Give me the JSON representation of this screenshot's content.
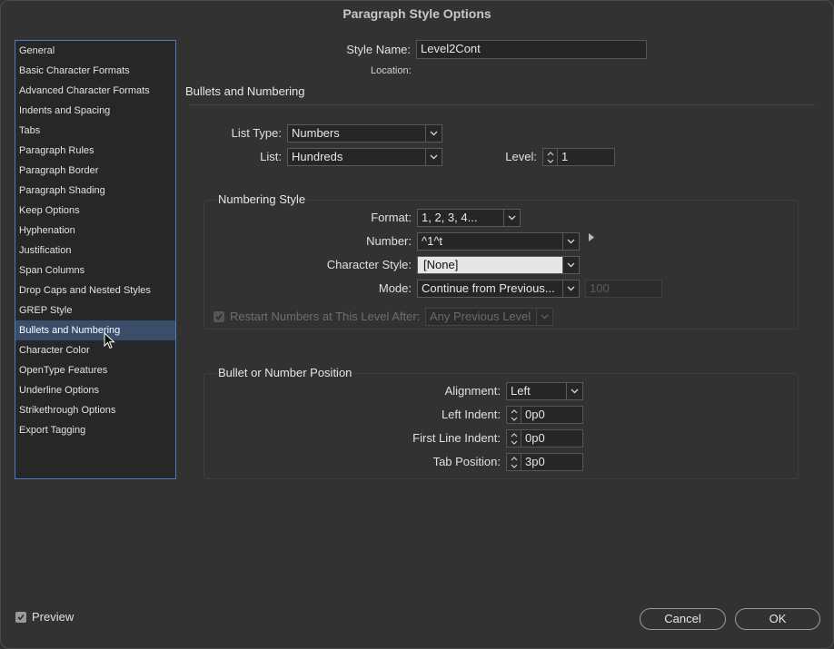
{
  "dialog": {
    "title": "Paragraph Style Options"
  },
  "sidebar": {
    "items": [
      {
        "label": "General"
      },
      {
        "label": "Basic Character Formats"
      },
      {
        "label": "Advanced Character Formats"
      },
      {
        "label": "Indents and Spacing"
      },
      {
        "label": "Tabs"
      },
      {
        "label": "Paragraph Rules"
      },
      {
        "label": "Paragraph Border"
      },
      {
        "label": "Paragraph Shading"
      },
      {
        "label": "Keep Options"
      },
      {
        "label": "Hyphenation"
      },
      {
        "label": "Justification"
      },
      {
        "label": "Span Columns"
      },
      {
        "label": "Drop Caps and Nested Styles"
      },
      {
        "label": "GREP Style"
      },
      {
        "label": "Bullets and Numbering",
        "selected": true
      },
      {
        "label": "Character Color"
      },
      {
        "label": "OpenType Features"
      },
      {
        "label": "Underline Options"
      },
      {
        "label": "Strikethrough Options"
      },
      {
        "label": "Export Tagging"
      }
    ]
  },
  "header": {
    "style_name_label": "Style Name:",
    "style_name_value": "Level2Cont",
    "location_label": "Location:"
  },
  "section": {
    "title": "Bullets and Numbering"
  },
  "list": {
    "list_type_label": "List Type:",
    "list_type_value": "Numbers",
    "list_label": "List:",
    "list_value": "Hundreds",
    "level_label": "Level:",
    "level_value": "1"
  },
  "numbering_style": {
    "title": "Numbering Style",
    "format_label": "Format:",
    "format_value": "1, 2, 3, 4...",
    "number_label": "Number:",
    "number_value": "^1^t",
    "char_style_label": "Character Style:",
    "char_style_value": "[None]",
    "mode_label": "Mode:",
    "mode_value": "Continue from Previous...",
    "mode_start_value": "100",
    "restart_label": "Restart Numbers at This Level After:",
    "restart_checked": true,
    "restart_value": "Any Previous Level"
  },
  "position": {
    "title": "Bullet or Number Position",
    "alignment_label": "Alignment:",
    "alignment_value": "Left",
    "left_indent_label": "Left Indent:",
    "left_indent_value": "0p0",
    "first_line_label": "First Line Indent:",
    "first_line_value": "0p0",
    "tab_position_label": "Tab Position:",
    "tab_position_value": "3p0"
  },
  "footer": {
    "preview_label": "Preview",
    "preview_checked": true,
    "cancel_label": "Cancel",
    "ok_label": "OK"
  },
  "colors": {
    "selection": "#3a4e6a",
    "sidebar_border": "#4a7cc0",
    "background": "#323232"
  }
}
